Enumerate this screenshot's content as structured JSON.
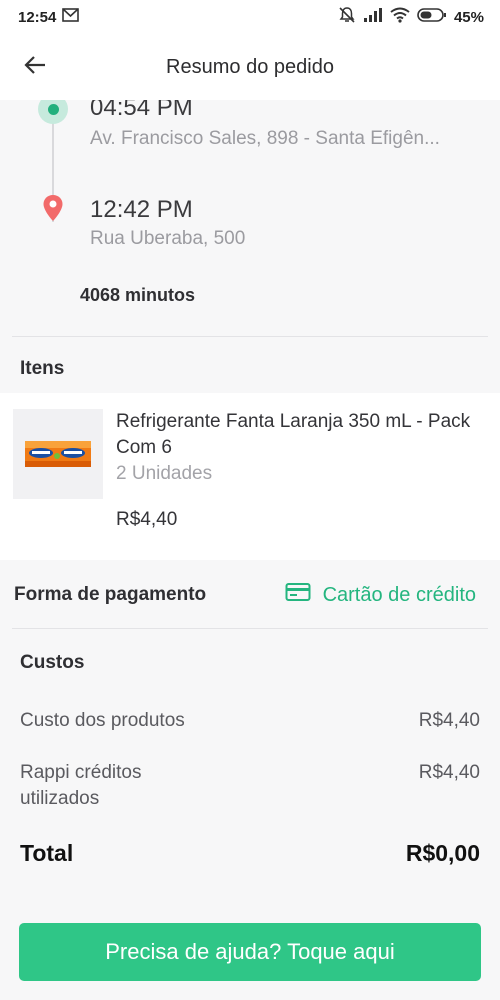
{
  "status_bar": {
    "time": "12:54",
    "battery": "45%",
    "icons": [
      "mail-icon",
      "mute-icon",
      "signal-icon",
      "wifi-icon",
      "battery-icon"
    ]
  },
  "header": {
    "title": "Resumo do pedido",
    "back_icon": "arrow-left-icon"
  },
  "route": {
    "origin_time": "04:54 PM",
    "origin_address": "Av. Francisco Sales, 898 - Santa Efigên...",
    "destination_time": "12:42 PM",
    "destination_address": "Rua Uberaba, 500",
    "duration": "4068 minutos",
    "origin_color": "#22b07d",
    "destination_color": "#f26a6a"
  },
  "items": {
    "title": "Itens",
    "list": [
      {
        "name": "Refrigerante Fanta Laranja 350 mL - Pack Com 6",
        "quantity": "2 Unidades",
        "price": "R$4,40",
        "image_icon": "fanta-pack-image"
      }
    ]
  },
  "payment": {
    "label": "Forma de pagamento",
    "method": "Cartão de crédito",
    "method_icon": "credit-card-icon",
    "accent": "#24b57f"
  },
  "costs": {
    "title": "Custos",
    "rows": [
      {
        "label": "Custo dos produtos",
        "value": "R$4,40"
      },
      {
        "label": "Rappi créditos utilizados",
        "value": "R$4,40"
      }
    ],
    "total_label": "Total",
    "total_value": "R$0,00"
  },
  "help_button": {
    "label": "Precisa de ajuda? Toque aqui",
    "color": "#2fc687"
  }
}
